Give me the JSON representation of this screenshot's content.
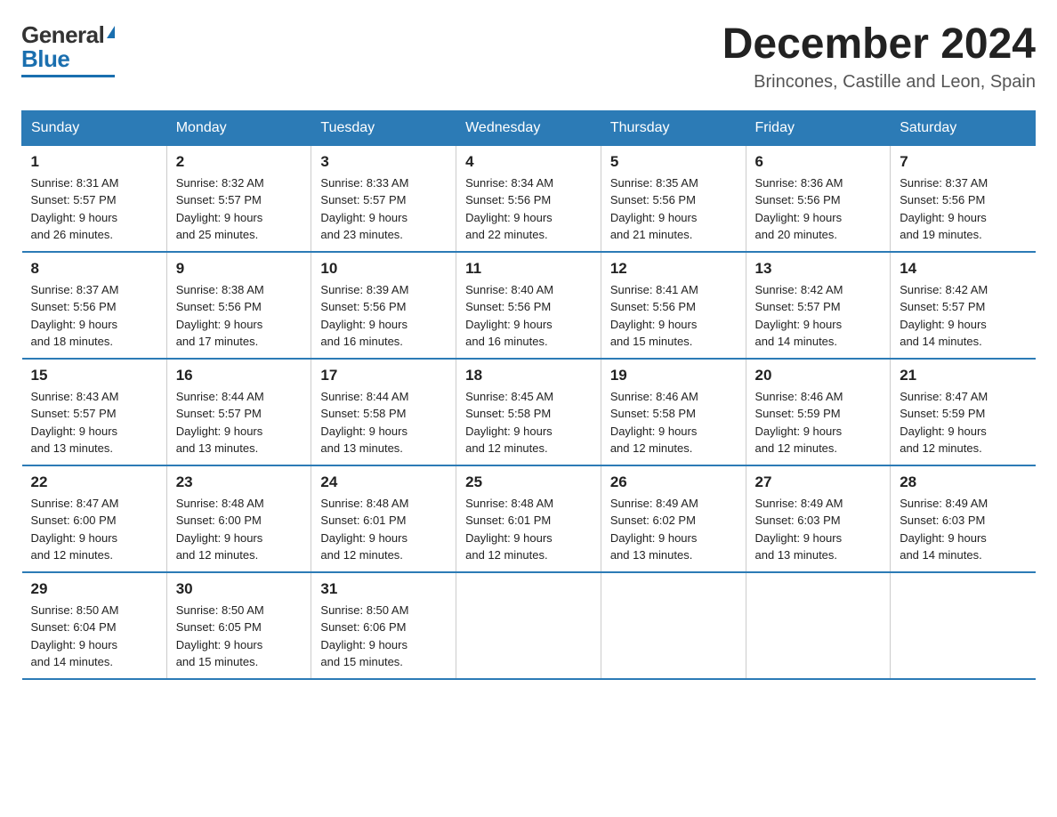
{
  "logo": {
    "general": "General",
    "blue": "Blue"
  },
  "title": "December 2024",
  "location": "Brincones, Castille and Leon, Spain",
  "headers": [
    "Sunday",
    "Monday",
    "Tuesday",
    "Wednesday",
    "Thursday",
    "Friday",
    "Saturday"
  ],
  "weeks": [
    [
      {
        "day": "1",
        "sunrise": "8:31 AM",
        "sunset": "5:57 PM",
        "daylight": "9 hours and 26 minutes."
      },
      {
        "day": "2",
        "sunrise": "8:32 AM",
        "sunset": "5:57 PM",
        "daylight": "9 hours and 25 minutes."
      },
      {
        "day": "3",
        "sunrise": "8:33 AM",
        "sunset": "5:57 PM",
        "daylight": "9 hours and 23 minutes."
      },
      {
        "day": "4",
        "sunrise": "8:34 AM",
        "sunset": "5:56 PM",
        "daylight": "9 hours and 22 minutes."
      },
      {
        "day": "5",
        "sunrise": "8:35 AM",
        "sunset": "5:56 PM",
        "daylight": "9 hours and 21 minutes."
      },
      {
        "day": "6",
        "sunrise": "8:36 AM",
        "sunset": "5:56 PM",
        "daylight": "9 hours and 20 minutes."
      },
      {
        "day": "7",
        "sunrise": "8:37 AM",
        "sunset": "5:56 PM",
        "daylight": "9 hours and 19 minutes."
      }
    ],
    [
      {
        "day": "8",
        "sunrise": "8:37 AM",
        "sunset": "5:56 PM",
        "daylight": "9 hours and 18 minutes."
      },
      {
        "day": "9",
        "sunrise": "8:38 AM",
        "sunset": "5:56 PM",
        "daylight": "9 hours and 17 minutes."
      },
      {
        "day": "10",
        "sunrise": "8:39 AM",
        "sunset": "5:56 PM",
        "daylight": "9 hours and 16 minutes."
      },
      {
        "day": "11",
        "sunrise": "8:40 AM",
        "sunset": "5:56 PM",
        "daylight": "9 hours and 16 minutes."
      },
      {
        "day": "12",
        "sunrise": "8:41 AM",
        "sunset": "5:56 PM",
        "daylight": "9 hours and 15 minutes."
      },
      {
        "day": "13",
        "sunrise": "8:42 AM",
        "sunset": "5:57 PM",
        "daylight": "9 hours and 14 minutes."
      },
      {
        "day": "14",
        "sunrise": "8:42 AM",
        "sunset": "5:57 PM",
        "daylight": "9 hours and 14 minutes."
      }
    ],
    [
      {
        "day": "15",
        "sunrise": "8:43 AM",
        "sunset": "5:57 PM",
        "daylight": "9 hours and 13 minutes."
      },
      {
        "day": "16",
        "sunrise": "8:44 AM",
        "sunset": "5:57 PM",
        "daylight": "9 hours and 13 minutes."
      },
      {
        "day": "17",
        "sunrise": "8:44 AM",
        "sunset": "5:58 PM",
        "daylight": "9 hours and 13 minutes."
      },
      {
        "day": "18",
        "sunrise": "8:45 AM",
        "sunset": "5:58 PM",
        "daylight": "9 hours and 12 minutes."
      },
      {
        "day": "19",
        "sunrise": "8:46 AM",
        "sunset": "5:58 PM",
        "daylight": "9 hours and 12 minutes."
      },
      {
        "day": "20",
        "sunrise": "8:46 AM",
        "sunset": "5:59 PM",
        "daylight": "9 hours and 12 minutes."
      },
      {
        "day": "21",
        "sunrise": "8:47 AM",
        "sunset": "5:59 PM",
        "daylight": "9 hours and 12 minutes."
      }
    ],
    [
      {
        "day": "22",
        "sunrise": "8:47 AM",
        "sunset": "6:00 PM",
        "daylight": "9 hours and 12 minutes."
      },
      {
        "day": "23",
        "sunrise": "8:48 AM",
        "sunset": "6:00 PM",
        "daylight": "9 hours and 12 minutes."
      },
      {
        "day": "24",
        "sunrise": "8:48 AM",
        "sunset": "6:01 PM",
        "daylight": "9 hours and 12 minutes."
      },
      {
        "day": "25",
        "sunrise": "8:48 AM",
        "sunset": "6:01 PM",
        "daylight": "9 hours and 12 minutes."
      },
      {
        "day": "26",
        "sunrise": "8:49 AM",
        "sunset": "6:02 PM",
        "daylight": "9 hours and 13 minutes."
      },
      {
        "day": "27",
        "sunrise": "8:49 AM",
        "sunset": "6:03 PM",
        "daylight": "9 hours and 13 minutes."
      },
      {
        "day": "28",
        "sunrise": "8:49 AM",
        "sunset": "6:03 PM",
        "daylight": "9 hours and 14 minutes."
      }
    ],
    [
      {
        "day": "29",
        "sunrise": "8:50 AM",
        "sunset": "6:04 PM",
        "daylight": "9 hours and 14 minutes."
      },
      {
        "day": "30",
        "sunrise": "8:50 AM",
        "sunset": "6:05 PM",
        "daylight": "9 hours and 15 minutes."
      },
      {
        "day": "31",
        "sunrise": "8:50 AM",
        "sunset": "6:06 PM",
        "daylight": "9 hours and 15 minutes."
      },
      null,
      null,
      null,
      null
    ]
  ]
}
